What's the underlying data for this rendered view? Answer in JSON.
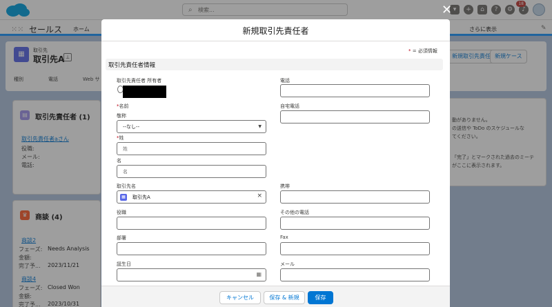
{
  "topbar": {
    "search_placeholder": "検索...",
    "notification_count": "18"
  },
  "nav": {
    "app_name": "セールス",
    "home": "ホーム",
    "more": "さらに表示"
  },
  "record": {
    "object_label": "取引先",
    "name": "取引先A",
    "actions": [
      "新規取引先責任者",
      "新規ケース"
    ],
    "highlight_fields": [
      "種別",
      "電話",
      "Web サ"
    ]
  },
  "contacts_card": {
    "title": "取引先責任者 (1)",
    "contact_name": "取引先責任者aさん",
    "labels": [
      "役職:",
      "メール:",
      "電話:"
    ]
  },
  "opps_card": {
    "title": "商談 (4)",
    "items": [
      {
        "name": "商談2",
        "phase_label": "フェーズ:",
        "phase": "Needs Analysis",
        "amount_label": "金額:",
        "close_label": "完了予...",
        "close": "2023/11/21"
      },
      {
        "name": "商談4",
        "phase_label": "フェーズ:",
        "phase": "Closed Won",
        "amount_label": "金額:",
        "close_label": "完了予...",
        "close": "2023/10/31"
      }
    ]
  },
  "activity": {
    "lines": [
      "動がありません。",
      "の送信や ToDo のスケジュールな",
      "てください。",
      "「完了」とマークされた過去のミーテ",
      "がここに表示されます。"
    ]
  },
  "modal": {
    "title": "新規取引先責任者",
    "required_legend": "= 必須情報",
    "section": "取引先責任者情報",
    "owner_label": "取引先責任者 所有者",
    "name_label": "名前",
    "salutation_label": "敬称",
    "salutation_value": "--なし--",
    "last_name_label": "姓",
    "last_name_placeholder": "姓",
    "first_name_label": "名",
    "first_name_placeholder": "名",
    "account_label": "取引先名",
    "account_value": "取引先A",
    "title_label": "役職",
    "department_label": "部署",
    "birthdate_label": "誕生日",
    "phone_label": "電話",
    "home_phone_label": "自宅電話",
    "mobile_label": "携帯",
    "other_phone_label": "その他の電話",
    "fax_label": "Fax",
    "email_label": "メール",
    "cancel": "キャンセル",
    "save_new": "保存 & 新規",
    "save": "保存"
  },
  "colors": {
    "brand": "#0176d3",
    "required": "#ba0517",
    "account_icon": "#5867e8",
    "opportunity_icon": "#ff5d2d"
  }
}
